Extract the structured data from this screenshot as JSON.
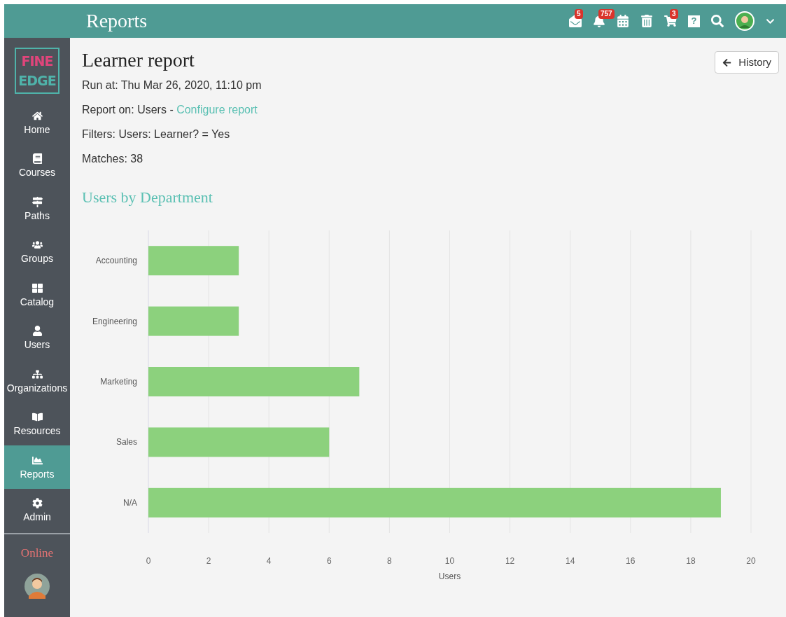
{
  "header": {
    "title": "Reports",
    "badges": [
      {
        "kind": "mail",
        "count": "5"
      },
      {
        "kind": "bell",
        "count": "757"
      },
      {
        "kind": "calendar"
      },
      {
        "kind": "trash"
      },
      {
        "kind": "cart",
        "count": "3"
      },
      {
        "kind": "help",
        "glyph": "?"
      },
      {
        "kind": "search"
      },
      {
        "kind": "avatar"
      },
      {
        "kind": "caret"
      }
    ]
  },
  "sidebar": {
    "logo": [
      "FINE",
      "EDGE"
    ],
    "items": [
      {
        "label": "Home",
        "selected": false
      },
      {
        "label": "Courses",
        "selected": false
      },
      {
        "label": "Paths",
        "selected": false
      },
      {
        "label": "Groups",
        "selected": false
      },
      {
        "label": "Catalog",
        "selected": false
      },
      {
        "label": "Users",
        "selected": false
      },
      {
        "label": "Organizations",
        "selected": false
      },
      {
        "label": "Resources",
        "selected": false
      },
      {
        "label": "Reports",
        "selected": true
      },
      {
        "label": "Admin",
        "selected": false
      }
    ],
    "status": "Online"
  },
  "report": {
    "title": "Learner report",
    "history_button": "History",
    "run_at": "Run at: Thu Mar 26, 2020, 11:10 pm",
    "report_on": "Report on: Users - ",
    "configure_link": "Configure report",
    "filters": "Filters: Users: Learner? = Yes",
    "matches": "Matches: 38",
    "chart_title": "Users by Department",
    "chart_data": {
      "type": "bar",
      "orientation": "horizontal",
      "grid": true,
      "xlabel": "Users",
      "categories": [
        "Accounting",
        "Engineering",
        "Marketing",
        "Sales",
        "N/A"
      ],
      "values": [
        3,
        3,
        7,
        6,
        19
      ],
      "xlim": [
        0,
        20
      ],
      "xticks": [
        0,
        2,
        4,
        6,
        8,
        10,
        12,
        14,
        16,
        18,
        20
      ]
    }
  }
}
